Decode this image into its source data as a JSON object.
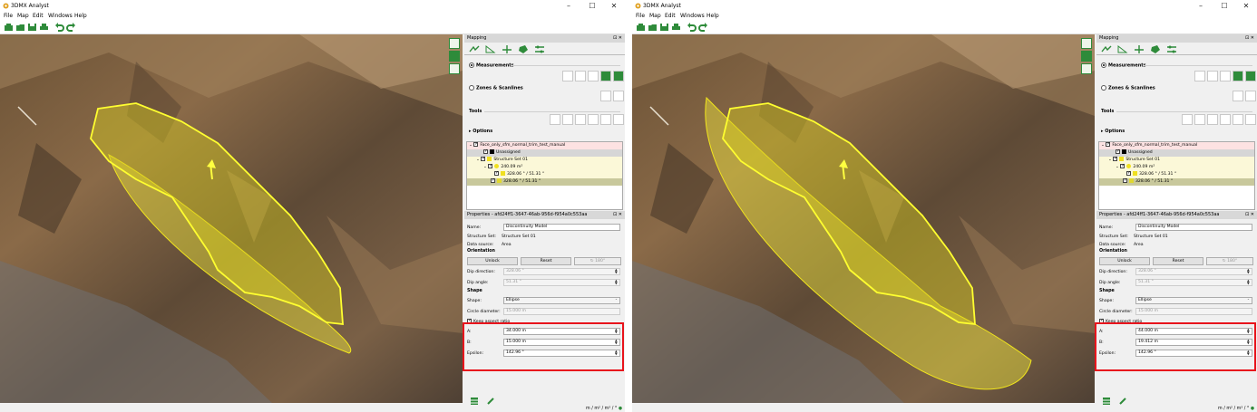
{
  "colors": {
    "accent": "#2e8b3a",
    "highlight": "#e8141c",
    "overlay": "#f5ea3c"
  },
  "windows": [
    {
      "id": "left",
      "title": "3DMX Analyst",
      "menu": [
        "File",
        "Map",
        "Edit",
        "Windows",
        "Help"
      ],
      "mapping_title": "Mapping",
      "measurements_label": "Measurements",
      "zones_label": "Zones & Scanlines",
      "tools_label": "Tools",
      "options_label": "Options",
      "tree": [
        "Face_only_sfm_normal_trim_test_manual",
        "Unassigned",
        "Structure Set 01",
        "240.09 m²",
        "328.06 ° / 51.31 °",
        "328.06 ° / 51.31 °"
      ],
      "properties_title": "Properties - afd24ff1-3647-46ab-956d-f954a0c553aa",
      "name_label": "Name:",
      "name_value": "Discontinuity Model",
      "structure_set_label": "Structure Set:",
      "structure_set_value": "Structure Set 01",
      "data_source_label": "Data source:",
      "data_source_value": "Area",
      "orientation_label": "Orientation",
      "unlock_label": "Unlock",
      "reset_label": "Reset",
      "flip_label": "180°",
      "dip_direction_label": "Dip direction:",
      "dip_direction_value": "328.06 °",
      "dip_angle_label": "Dip angle:",
      "dip_angle_value": "51.31 °",
      "shape_section_label": "Shape",
      "shape_label": "Shape:",
      "shape_value": "Ellipse",
      "circle_diameter_label": "Circle diameter:",
      "circle_diameter_value": "15.000 m",
      "keep_aspect_label": "Keep aspect ratio",
      "a_label": "A:",
      "a_value": "34.000 m",
      "b_label": "B:",
      "b_value": "15.000 m",
      "epsilon_label": "Epsilon:",
      "epsilon_value": "142.96 °",
      "status": "m / m² / m³ / °"
    },
    {
      "id": "right",
      "title": "3DMX Analyst",
      "menu": [
        "File",
        "Map",
        "Edit",
        "Windows",
        "Help"
      ],
      "mapping_title": "Mapping",
      "measurements_label": "Measurements",
      "zones_label": "Zones & Scanlines",
      "tools_label": "Tools",
      "options_label": "Options",
      "tree": [
        "Face_only_sfm_normal_trim_test_manual",
        "Unassigned",
        "Structure Set 01",
        "240.09 m²",
        "328.06 ° / 51.31 °",
        "328.06 ° / 51.31 °"
      ],
      "properties_title": "Properties - afd24ff1-3647-46ab-956d-f954a0c553aa",
      "name_label": "Name:",
      "name_value": "Discontinuity Model",
      "structure_set_label": "Structure Set:",
      "structure_set_value": "Structure Set 01",
      "data_source_label": "Data source:",
      "data_source_value": "Area",
      "orientation_label": "Orientation",
      "unlock_label": "Unlock",
      "reset_label": "Reset",
      "flip_label": "180°",
      "dip_direction_label": "Dip direction:",
      "dip_direction_value": "328.06 °",
      "dip_angle_label": "Dip angle:",
      "dip_angle_value": "51.31 °",
      "shape_section_label": "Shape",
      "shape_label": "Shape:",
      "shape_value": "Ellipse",
      "circle_diameter_label": "Circle diameter:",
      "circle_diameter_value": "15.000 m",
      "keep_aspect_label": "Keep aspect ratio",
      "a_label": "A:",
      "a_value": "44.000 m",
      "b_label": "B:",
      "b_value": "19.412 m",
      "epsilon_label": "Epsilon:",
      "epsilon_value": "142.96 °",
      "status": "m / m² / m³ / °"
    }
  ]
}
